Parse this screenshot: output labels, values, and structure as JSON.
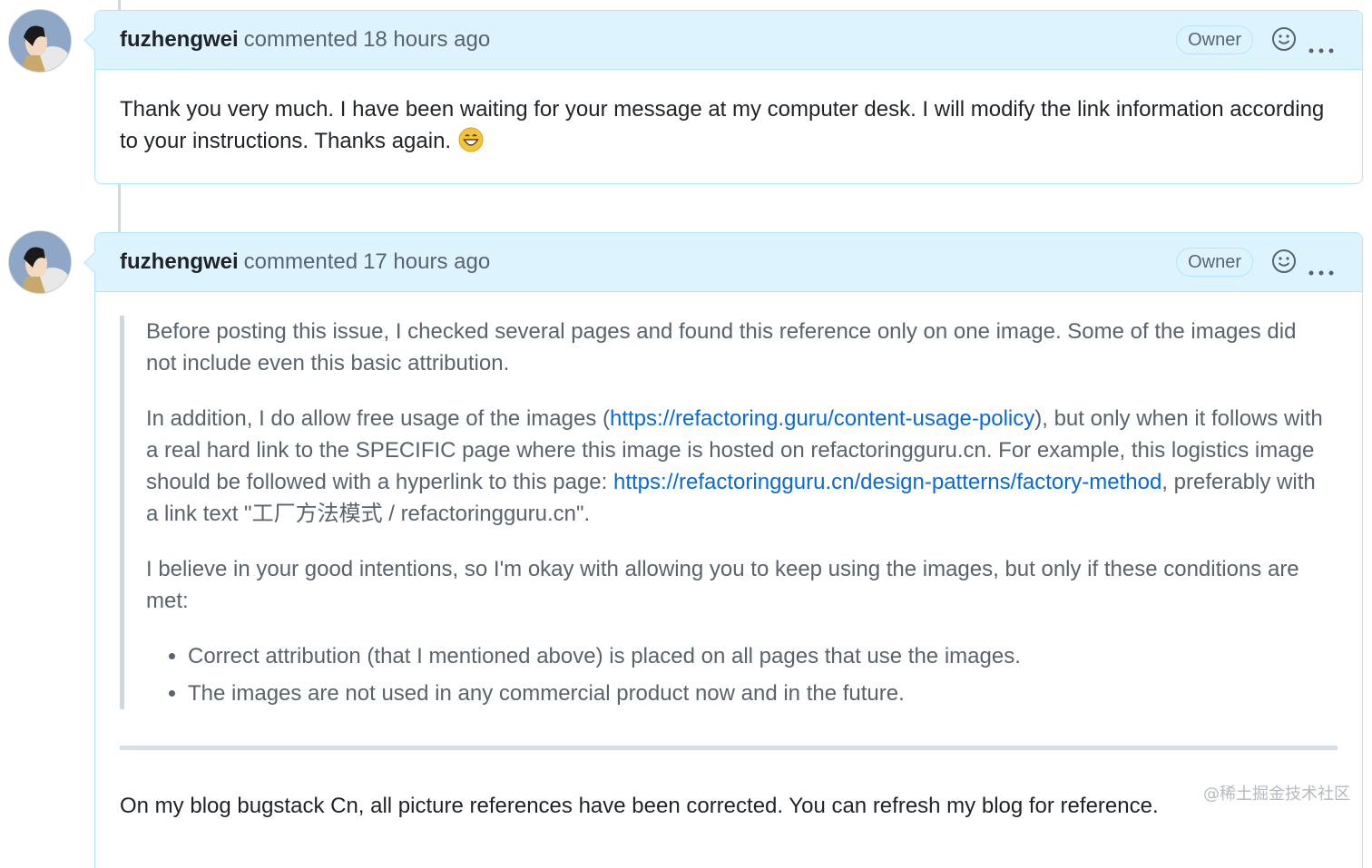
{
  "comments": [
    {
      "author": "fuzhengwei",
      "action": "commented",
      "time": "18 hours ago",
      "badge": "Owner",
      "body": "Thank you very much. I have been waiting for your message at my computer desk. I will modify the link information according to your instructions. Thanks again."
    },
    {
      "author": "fuzhengwei",
      "action": "commented",
      "time": "17 hours ago",
      "badge": "Owner",
      "quote": {
        "p1": "Before posting this issue, I checked several pages and found this reference only on one image. Some of the images did not include even this basic attribution.",
        "p2_before": "In addition, I do allow free usage of the images (",
        "p2_link1": "https://refactoring.guru/content-usage-policy",
        "p2_middle": "), but only when it follows with a real hard link to the SPECIFIC page where this image is hosted on refactoringguru.cn. For example, this logistics image should be followed with a hyperlink to this page: ",
        "p2_link2": "https://refactoringguru.cn/design-patterns/factory-method",
        "p2_after": ", preferably with a link text \"工厂方法模式 / refactoringguru.cn\".",
        "p3": "I believe in your good intentions, so I'm okay with allowing you to keep using the images, but only if these conditions are met:",
        "bullets": [
          "Correct attribution (that I mentioned above) is placed on all pages that use the images.",
          "The images are not used in any commercial product now and in the future."
        ]
      },
      "footer_text": "On my blog bugstack Cn, all picture references have been corrected. You can refresh my blog for reference."
    }
  ],
  "watermark": "@稀土掘金技术社区",
  "icons": [
    "smiley-icon",
    "kebab-menu-icon",
    "grinning-emoji-icon"
  ],
  "colors": {
    "header_bg": "#ddf4ff",
    "header_border": "#b6e3ff",
    "link": "#0969da",
    "muted": "#59636e"
  }
}
